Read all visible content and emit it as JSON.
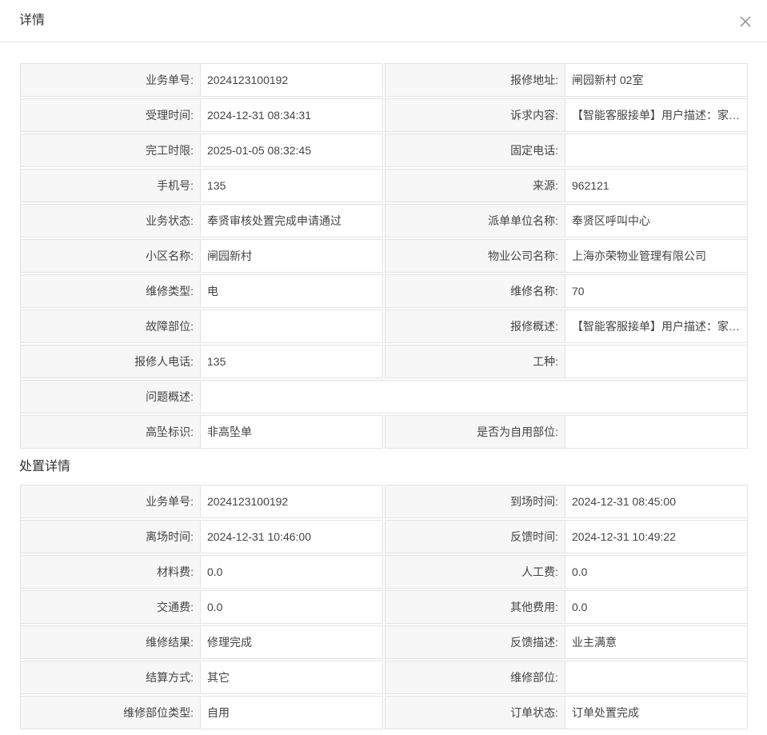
{
  "dialog": {
    "title": "详情"
  },
  "details": [
    {
      "label": "业务单号:",
      "value": "2024123100192"
    },
    {
      "label": "报修地址:",
      "value": "闸园新村    02室"
    },
    {
      "label": "受理时间:",
      "value": "2024-12-31 08:34:31"
    },
    {
      "label": "诉求内容:",
      "value": "【智能客服接单】用户描述：家中电路故障"
    },
    {
      "label": "完工时限:",
      "value": "2025-01-05 08:32:45"
    },
    {
      "label": "固定电话:",
      "value": ""
    },
    {
      "label": "手机号:",
      "value": "135"
    },
    {
      "label": "来源:",
      "value": "962121"
    },
    {
      "label": "业务状态:",
      "value": "奉贤审核处置完成申请通过"
    },
    {
      "label": "派单单位名称:",
      "value": "奉贤区呼叫中心"
    },
    {
      "label": "小区名称:",
      "value": "闸园新村"
    },
    {
      "label": "物业公司名称:",
      "value": "上海亦荣物业管理有限公司"
    },
    {
      "label": "维修类型:",
      "value": "电"
    },
    {
      "label": "维修名称:",
      "value": "70"
    },
    {
      "label": "故障部位:",
      "value": ""
    },
    {
      "label": "报修概述:",
      "value": "【智能客服接单】用户描述：家中电路故障"
    },
    {
      "label": "报修人电话:",
      "value": "135"
    },
    {
      "label": "工种:",
      "value": ""
    },
    {
      "label": "问题概述:",
      "value": "",
      "full": true
    },
    {
      "label": "高坠标识:",
      "value": "非高坠单"
    },
    {
      "label": "是否为自用部位:",
      "value": ""
    }
  ],
  "disposal": {
    "title": "处置详情",
    "rows": [
      {
        "label": "业务单号:",
        "value": "2024123100192"
      },
      {
        "label": "到场时间:",
        "value": "2024-12-31 08:45:00"
      },
      {
        "label": "离场时间:",
        "value": "2024-12-31 10:46:00"
      },
      {
        "label": "反馈时间:",
        "value": "2024-12-31 10:49:22"
      },
      {
        "label": "材料费:",
        "value": "0.0"
      },
      {
        "label": "人工费:",
        "value": "0.0"
      },
      {
        "label": "交通费:",
        "value": "0.0"
      },
      {
        "label": "其他费用:",
        "value": "0.0"
      },
      {
        "label": "维修结果:",
        "value": "修理完成"
      },
      {
        "label": "反馈描述:",
        "value": "业主满意"
      },
      {
        "label": "结算方式:",
        "value": "其它"
      },
      {
        "label": "维修部位:",
        "value": ""
      },
      {
        "label": "维修部位类型:",
        "value": "自用"
      },
      {
        "label": "订单状态:",
        "value": "订单处置完成"
      }
    ]
  },
  "icons": {
    "close": "close-icon"
  }
}
